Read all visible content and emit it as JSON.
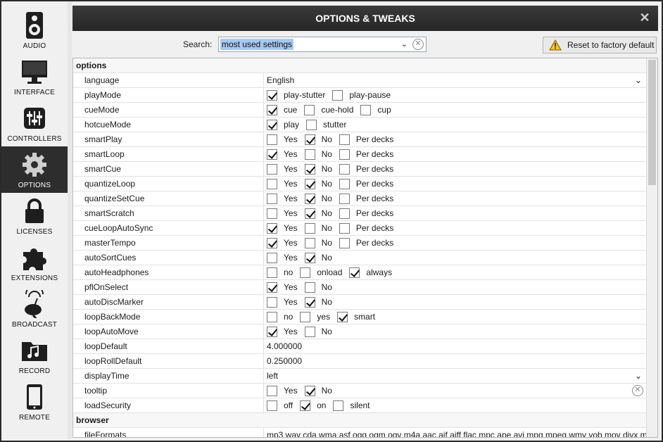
{
  "sidebar": {
    "items": [
      {
        "label": "AUDIO",
        "icon": "speaker-icon"
      },
      {
        "label": "INTERFACE",
        "icon": "monitor-icon"
      },
      {
        "label": "CONTROLLERS",
        "icon": "sliders-icon"
      },
      {
        "label": "OPTIONS",
        "icon": "gear-icon",
        "active": true
      },
      {
        "label": "LICENSES",
        "icon": "lock-icon"
      },
      {
        "label": "EXTENSIONS",
        "icon": "puzzle-icon"
      },
      {
        "label": "BROADCAST",
        "icon": "satellite-dish-icon"
      },
      {
        "label": "RECORD",
        "icon": "music-folder-icon"
      },
      {
        "label": "REMOTE",
        "icon": "phone-icon"
      }
    ]
  },
  "dialog": {
    "title": "OPTIONS & TWEAKS",
    "close_symbol": "✕"
  },
  "search": {
    "label": "Search:",
    "value": "most used settings",
    "dropdown_symbol": "⌄",
    "clear_symbol": "✕"
  },
  "reset_button": {
    "label": "Reset to factory default"
  },
  "sections": [
    {
      "title": "options",
      "rows": [
        {
          "name": "language",
          "type": "select",
          "value": "English"
        },
        {
          "name": "playMode",
          "type": "checks",
          "options": [
            {
              "label": "play-stutter",
              "checked": true
            },
            {
              "label": "play-pause",
              "checked": false
            }
          ]
        },
        {
          "name": "cueMode",
          "type": "checks",
          "options": [
            {
              "label": "cue",
              "checked": true
            },
            {
              "label": "cue-hold",
              "checked": false
            },
            {
              "label": "cup",
              "checked": false
            }
          ]
        },
        {
          "name": "hotcueMode",
          "type": "checks",
          "options": [
            {
              "label": "play",
              "checked": true
            },
            {
              "label": "stutter",
              "checked": false
            }
          ]
        },
        {
          "name": "smartPlay",
          "type": "checks",
          "options": [
            {
              "label": "Yes",
              "checked": false
            },
            {
              "label": "No",
              "checked": true
            },
            {
              "label": "Per decks",
              "checked": false
            }
          ]
        },
        {
          "name": "smartLoop",
          "type": "checks",
          "options": [
            {
              "label": "Yes",
              "checked": true
            },
            {
              "label": "No",
              "checked": false
            },
            {
              "label": "Per decks",
              "checked": false
            }
          ]
        },
        {
          "name": "smartCue",
          "type": "checks",
          "options": [
            {
              "label": "Yes",
              "checked": false
            },
            {
              "label": "No",
              "checked": true
            },
            {
              "label": "Per decks",
              "checked": false
            }
          ]
        },
        {
          "name": "quantizeLoop",
          "type": "checks",
          "options": [
            {
              "label": "Yes",
              "checked": false
            },
            {
              "label": "No",
              "checked": true
            },
            {
              "label": "Per decks",
              "checked": false
            }
          ]
        },
        {
          "name": "quantizeSetCue",
          "type": "checks",
          "options": [
            {
              "label": "Yes",
              "checked": false
            },
            {
              "label": "No",
              "checked": true
            },
            {
              "label": "Per decks",
              "checked": false
            }
          ]
        },
        {
          "name": "smartScratch",
          "type": "checks",
          "options": [
            {
              "label": "Yes",
              "checked": false
            },
            {
              "label": "No",
              "checked": true
            },
            {
              "label": "Per decks",
              "checked": false
            }
          ]
        },
        {
          "name": "cueLoopAutoSync",
          "type": "checks",
          "options": [
            {
              "label": "Yes",
              "checked": true
            },
            {
              "label": "No",
              "checked": false
            },
            {
              "label": "Per decks",
              "checked": false
            }
          ]
        },
        {
          "name": "masterTempo",
          "type": "checks",
          "options": [
            {
              "label": "Yes",
              "checked": true
            },
            {
              "label": "No",
              "checked": false
            },
            {
              "label": "Per decks",
              "checked": false
            }
          ]
        },
        {
          "name": "autoSortCues",
          "type": "checks",
          "options": [
            {
              "label": "Yes",
              "checked": false
            },
            {
              "label": "No",
              "checked": true
            }
          ]
        },
        {
          "name": "autoHeadphones",
          "type": "checks",
          "options": [
            {
              "label": "no",
              "checked": false
            },
            {
              "label": "onload",
              "checked": false
            },
            {
              "label": "always",
              "checked": true
            }
          ]
        },
        {
          "name": "pflOnSelect",
          "type": "checks",
          "options": [
            {
              "label": "Yes",
              "checked": true
            },
            {
              "label": "No",
              "checked": false
            }
          ]
        },
        {
          "name": "autoDiscMarker",
          "type": "checks",
          "options": [
            {
              "label": "Yes",
              "checked": false
            },
            {
              "label": "No",
              "checked": true
            }
          ]
        },
        {
          "name": "loopBackMode",
          "type": "checks",
          "options": [
            {
              "label": "no",
              "checked": false
            },
            {
              "label": "yes",
              "checked": false
            },
            {
              "label": "smart",
              "checked": true
            }
          ]
        },
        {
          "name": "loopAutoMove",
          "type": "checks",
          "options": [
            {
              "label": "Yes",
              "checked": true
            },
            {
              "label": "No",
              "checked": false
            }
          ]
        },
        {
          "name": "loopDefault",
          "type": "text",
          "value": "4.000000"
        },
        {
          "name": "loopRollDefault",
          "type": "text",
          "value": "0.250000"
        },
        {
          "name": "displayTime",
          "type": "select",
          "value": "left"
        },
        {
          "name": "tooltip",
          "type": "checks",
          "clearable": true,
          "options": [
            {
              "label": "Yes",
              "checked": false
            },
            {
              "label": "No",
              "checked": true
            }
          ]
        },
        {
          "name": "loadSecurity",
          "type": "checks",
          "options": [
            {
              "label": "off",
              "checked": false
            },
            {
              "label": "on",
              "checked": true
            },
            {
              "label": "silent",
              "checked": false
            }
          ]
        }
      ]
    },
    {
      "title": "browser",
      "rows": [
        {
          "name": "fileFormats",
          "type": "text",
          "value": "mp3 wav cda wma asf ogg ogm ogv m4a aac aif aiff flac mpc ape avi mpg mpeg wmv vob mov divx m"
        }
      ]
    }
  ]
}
